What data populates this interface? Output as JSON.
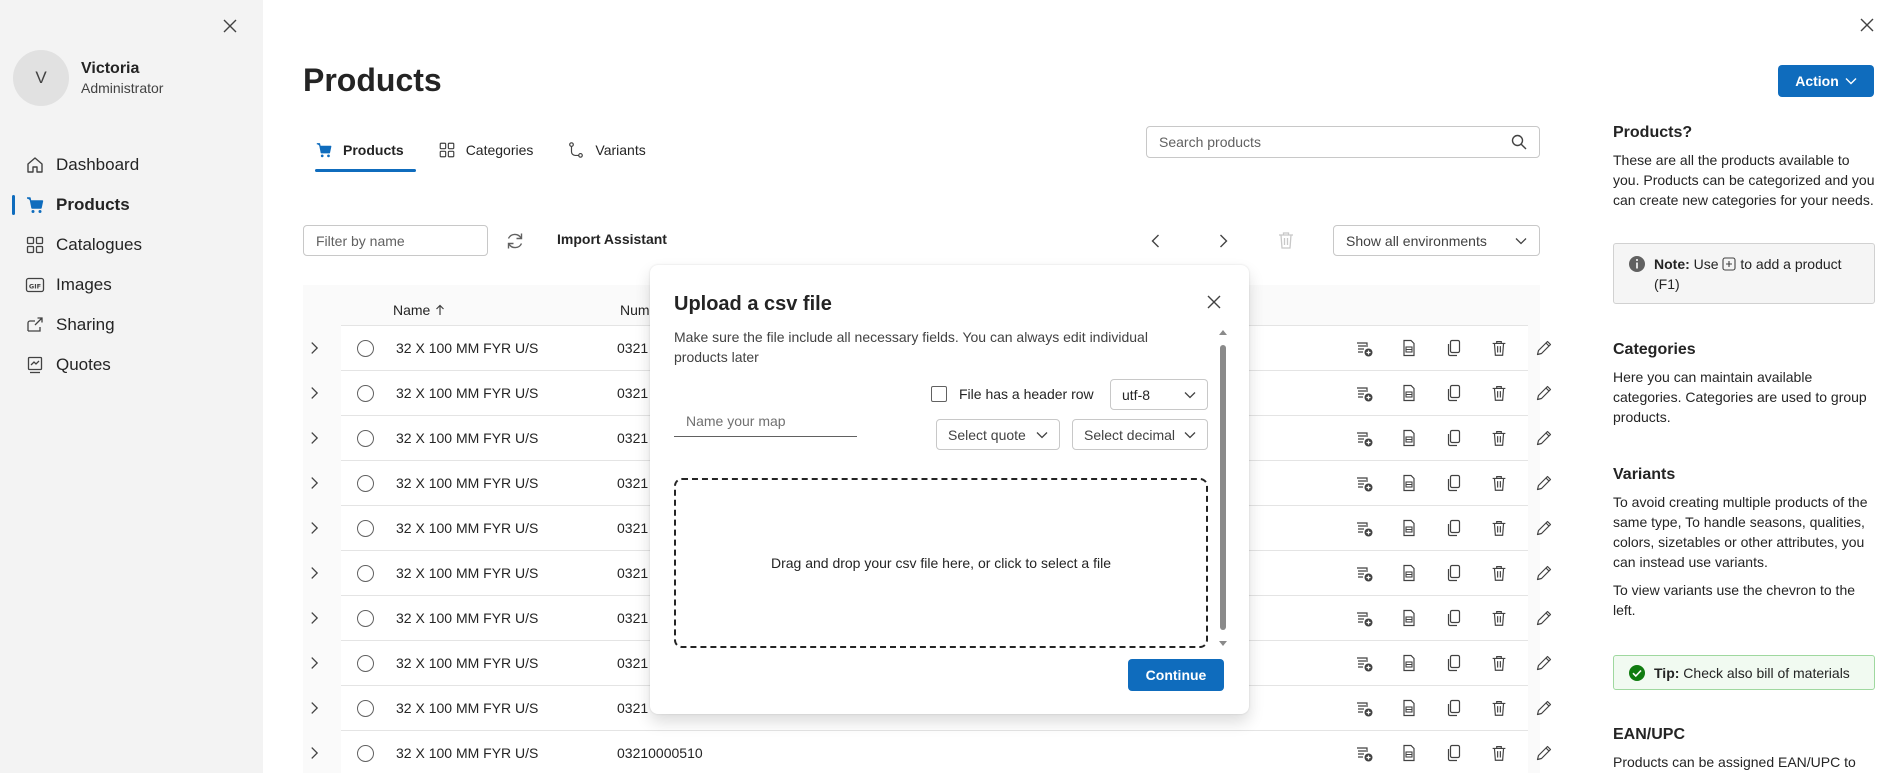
{
  "app": {
    "close_icon": "close-icon",
    "accent_color": "#0f6cbd"
  },
  "sidebar": {
    "close_icon": "close-icon",
    "profile": {
      "initial": "V",
      "name": "Victoria",
      "role": "Administrator"
    },
    "items": [
      {
        "label": "Dashboard",
        "icon": "home-icon",
        "active": false
      },
      {
        "label": "Products",
        "icon": "cart-icon",
        "active": true
      },
      {
        "label": "Catalogues",
        "icon": "grid-icon",
        "active": false
      },
      {
        "label": "Images",
        "icon": "gif-icon",
        "active": false
      },
      {
        "label": "Sharing",
        "icon": "share-icon",
        "active": false
      },
      {
        "label": "Quotes",
        "icon": "quote-icon",
        "active": false
      }
    ]
  },
  "header": {
    "title": "Products",
    "action_label": "Action",
    "search_placeholder": "Search products"
  },
  "tabs": [
    {
      "label": "Products",
      "icon": "cart-icon",
      "active": true
    },
    {
      "label": "Categories",
      "icon": "grid-icon",
      "active": false
    },
    {
      "label": "Variants",
      "icon": "branch-icon",
      "active": false
    }
  ],
  "toolbar": {
    "filter_placeholder": "Filter by name",
    "import_label": "Import Assistant",
    "environment_value": "Show all environments"
  },
  "table": {
    "columns": {
      "name": "Name",
      "number": "Num"
    },
    "rows": [
      {
        "name": "32 X 100 MM FYR U/S",
        "number": "0321"
      },
      {
        "name": "32 X 100 MM FYR U/S",
        "number": "0321"
      },
      {
        "name": "32 X 100 MM FYR U/S",
        "number": "0321"
      },
      {
        "name": "32 X 100 MM FYR U/S",
        "number": "0321"
      },
      {
        "name": "32 X 100 MM FYR U/S",
        "number": "0321"
      },
      {
        "name": "32 X 100 MM FYR U/S",
        "number": "0321"
      },
      {
        "name": "32 X 100 MM FYR U/S",
        "number": "0321"
      },
      {
        "name": "32 X 100 MM FYR U/S",
        "number": "0321"
      },
      {
        "name": "32 X 100 MM FYR U/S",
        "number": "0321"
      },
      {
        "name": "32 X 100 MM FYR U/S",
        "number": "03210000510"
      }
    ]
  },
  "help": {
    "products_title": "Products?",
    "products_text": "These are all the products available to you. Products can be categorized and you can create new categories for your needs.",
    "note_label": "Note:",
    "note_text_before": "Use",
    "note_text_after": "to add a product (F1)",
    "categories_title": "Categories",
    "categories_text": "Here you can maintain available categories. Categories are used to group products.",
    "variants_title": "Variants",
    "variants_text": "To avoid creating multiple products of the same type, To handle seasons, qualities, colors, sizetables or other attributes, you can instead use variants.",
    "variants_text2": "To view variants use the chevron to the left.",
    "tip_label": "Tip:",
    "tip_text": "Check also bill of materials",
    "ean_title": "EAN/UPC",
    "ean_text": "Products can be assigned EAN/UPC to"
  },
  "modal": {
    "title": "Upload a csv file",
    "description": "Make sure the file include all necessary fields. You can always edit individual products later",
    "map_placeholder": "Name your map",
    "header_row_label": "File has a header row",
    "encoding_value": "utf-8",
    "quote_value": "Select quote",
    "decimal_value": "Select decimal",
    "dropzone_text": "Drag and drop your csv file here, or click to select a file",
    "continue_label": "Continue"
  }
}
